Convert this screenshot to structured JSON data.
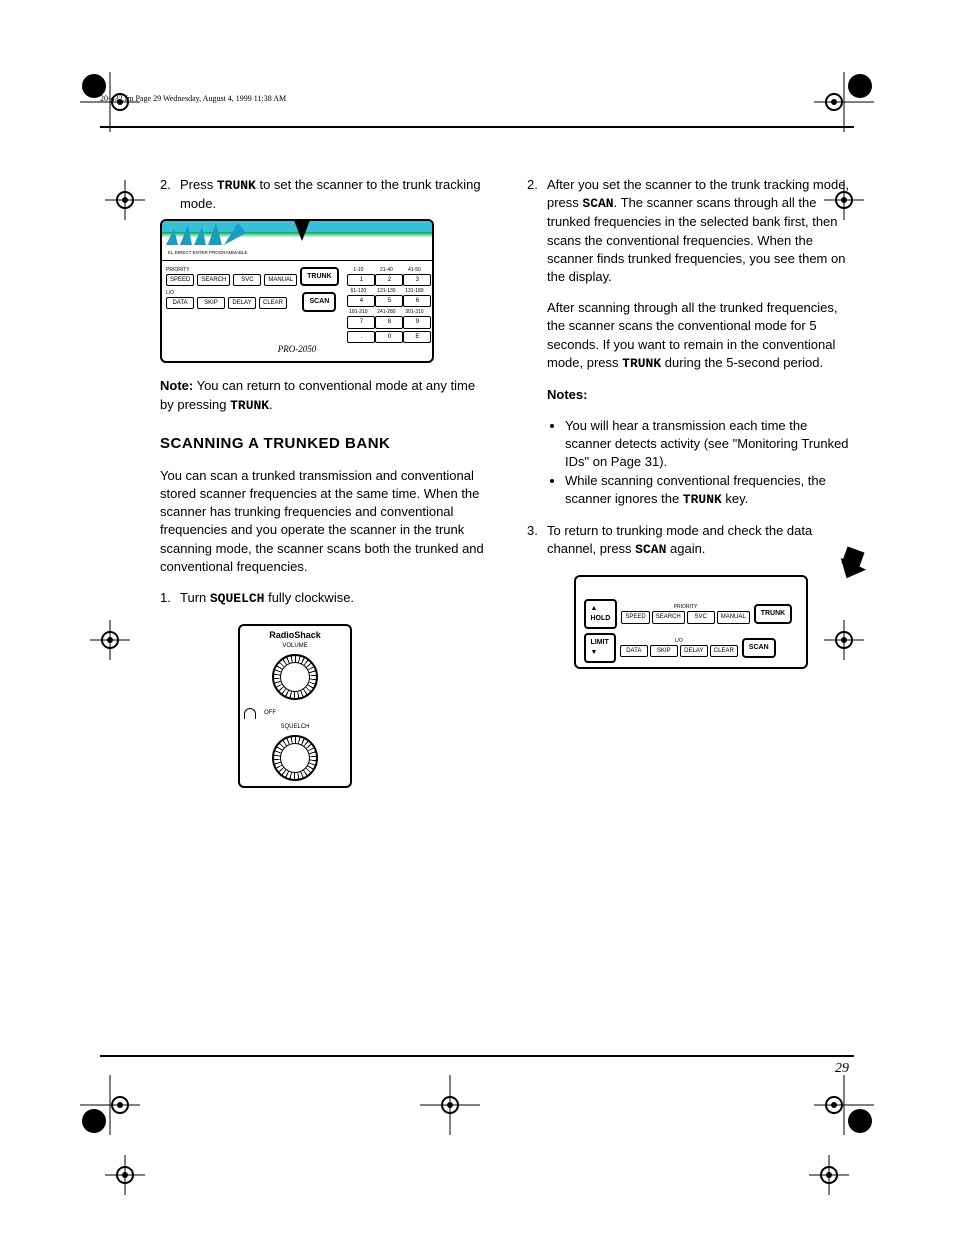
{
  "header": {
    "filename": "20-432.fm  Page 29  Wednesday, August 4, 1999  11:38 AM"
  },
  "page_number": "29",
  "col_left": {
    "step2": {
      "num": "2.",
      "text_before": "Press ",
      "key": "TRUNK",
      "text_after": " to set the scanner to the trunk tracking mode."
    },
    "note_label": "Note:",
    "note_text": " You can return to conventional mode at any time by pressing ",
    "note_key": "TRUNK",
    "note_end": ".",
    "scanning_title": "SCANNING A TRUNKED BANK",
    "scanning_p": "You can scan a trunked transmission and conventional stored scanner frequencies at the same time. When the scanner has trunking frequencies and conventional frequencies and you operate the scanner in the trunk scanning mode, the scanner scans both the trunked and conventional frequencies.",
    "step1b": {
      "num": "1.",
      "text": "Turn ",
      "ctl": "SQUELCH",
      "text2": " fully clockwise."
    }
  },
  "col_right": {
    "step2b": {
      "num": "2.",
      "text": "After you set the scanner to the trunk tracking mode, press ",
      "key": "SCAN",
      "text2": ". The scanner scans through all the trunked frequencies in the selected bank first, then scans the conventional frequencies. When the scanner finds trunked frequencies, you see them on the display."
    },
    "warn_p1a": "After scanning through all the trunked frequencies, the scanner scans the conventional mode for 5 seconds. If you want to remain in the conventional mode, press ",
    "warn_key": "TRUNK",
    "warn_p1b": " during the 5-second period.",
    "notes_label": "Notes:",
    "note1": "You will hear a transmission each time the scanner detects activity (see \"Monitoring Trunked IDs\" on Page 31).",
    "note2a": "While scanning conventional frequencies, the scanner ignores the ",
    "note2_key": "TRUNK",
    "note2b": " key.",
    "step3": {
      "num": "3.",
      "text": "To return to trunking mode and check the data channel, press ",
      "key": "SCAN",
      "text2": " again."
    }
  },
  "fig1": {
    "display_label": "EL DIRECT ENTER PROGRAMMABLE",
    "row1": {
      "lbl": "PRIORITY",
      "btns": [
        "SPEED",
        "SEARCH",
        "SVC",
        "MANUAL"
      ]
    },
    "row2": {
      "lbl": "L/O",
      "btns": [
        "DATA",
        "SKIP",
        "DELAY",
        "CLEAR"
      ]
    },
    "big1": "TRUNK",
    "big2": "SCAN",
    "keypad_labels": [
      "1-10",
      "21-40",
      "41-50",
      "61-120",
      "121-130",
      "131-180",
      "181-210",
      "241-280",
      "301-310"
    ],
    "keypad": [
      "1",
      "2",
      "3",
      "4",
      "5",
      "6",
      "7",
      "8",
      "9",
      ".",
      "0",
      "E"
    ],
    "model": "PRO-2050"
  },
  "fig2": {
    "brand": "RadioShack",
    "vol": "VOLUME",
    "off": "OFF",
    "sq": "SQUELCH"
  },
  "fig3": {
    "hold": "HOLD",
    "limit": "LIMIT",
    "pri": "PRIORITY",
    "lo": "L/O",
    "row1": [
      "SPEED",
      "SEARCH",
      "SVC",
      "MANUAL"
    ],
    "row2": [
      "DATA",
      "SKIP",
      "DELAY",
      "CLEAR"
    ],
    "big1": "TRUNK",
    "big2": "SCAN"
  }
}
